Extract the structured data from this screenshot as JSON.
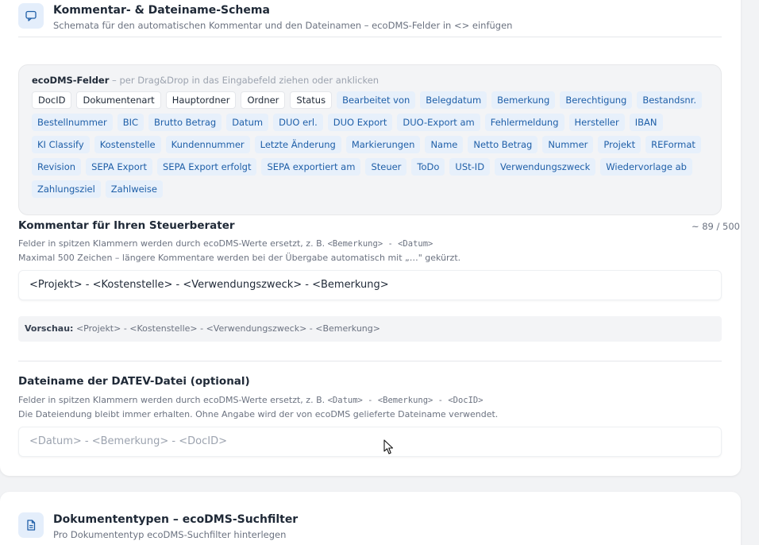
{
  "schema_section": {
    "title": "Kommentar- & Dateiname-Schema",
    "subtitle": "Schemata für den automatischen Kommentar und den Dateinamen – ecoDMS-Felder in <> einfügen",
    "icon": "chat-bubble-icon"
  },
  "fields_panel": {
    "heading": "ecoDMS-Felder",
    "hint": " – per Drag&Drop in das Eingabefeld ziehen oder anklicken",
    "chips": [
      {
        "label": "DocID",
        "style": "neutral"
      },
      {
        "label": "Dokumentenart",
        "style": "neutral"
      },
      {
        "label": "Hauptordner",
        "style": "neutral"
      },
      {
        "label": "Ordner",
        "style": "neutral"
      },
      {
        "label": "Status",
        "style": "neutral"
      },
      {
        "label": "Bearbeitet von",
        "style": "blue"
      },
      {
        "label": "Belegdatum",
        "style": "blue"
      },
      {
        "label": "Bemerkung",
        "style": "blue"
      },
      {
        "label": "Berechtigung",
        "style": "blue"
      },
      {
        "label": "Bestandsnr.",
        "style": "blue"
      },
      {
        "label": "Bestellnummer",
        "style": "blue"
      },
      {
        "label": "BIC",
        "style": "blue"
      },
      {
        "label": "Brutto Betrag",
        "style": "blue"
      },
      {
        "label": "Datum",
        "style": "blue"
      },
      {
        "label": "DUO erl.",
        "style": "blue"
      },
      {
        "label": "DUO Export",
        "style": "blue"
      },
      {
        "label": "DUO-Export am",
        "style": "blue"
      },
      {
        "label": "Fehlermeldung",
        "style": "blue"
      },
      {
        "label": "Hersteller",
        "style": "blue"
      },
      {
        "label": "IBAN",
        "style": "blue"
      },
      {
        "label": "KI Classify",
        "style": "blue"
      },
      {
        "label": "Kostenstelle",
        "style": "blue"
      },
      {
        "label": "Kundennummer",
        "style": "blue"
      },
      {
        "label": "Letzte Änderung",
        "style": "blue"
      },
      {
        "label": "Markierungen",
        "style": "blue"
      },
      {
        "label": "Name",
        "style": "blue"
      },
      {
        "label": "Netto Betrag",
        "style": "blue"
      },
      {
        "label": "Nummer",
        "style": "blue"
      },
      {
        "label": "Projekt",
        "style": "blue"
      },
      {
        "label": "REFormat",
        "style": "blue"
      },
      {
        "label": "Revision",
        "style": "blue"
      },
      {
        "label": "SEPA Export",
        "style": "blue"
      },
      {
        "label": "SEPA Export erfolgt",
        "style": "blue"
      },
      {
        "label": "SEPA exportiert am",
        "style": "blue"
      },
      {
        "label": "Steuer",
        "style": "blue"
      },
      {
        "label": "ToDo",
        "style": "blue"
      },
      {
        "label": "USt-ID",
        "style": "blue"
      },
      {
        "label": "Verwendungszweck",
        "style": "blue"
      },
      {
        "label": "Wiedervorlage ab",
        "style": "blue"
      },
      {
        "label": "Zahlungsziel",
        "style": "blue"
      },
      {
        "label": "Zahlweise",
        "style": "blue"
      }
    ]
  },
  "comment": {
    "title": "Kommentar für Ihren Steuerberater",
    "counter": "~ 89 / 500",
    "help1_prefix": "Felder in spitzen Klammern werden durch ecoDMS-Werte ersetzt, z. B. ",
    "help1_example": "<Bemerkung> - <Datum>",
    "help2": "Maximal 500 Zeichen – längere Kommentare werden bei der Übergabe automatisch mit „…\" gekürzt.",
    "value": "<Projekt> - <Kostenstelle> - <Verwendungszweck> - <Bemerkung>",
    "preview_label": "Vorschau:",
    "preview_value": " <Projekt> - <Kostenstelle> - <Verwendungszweck> - <Bemerkung>"
  },
  "filename": {
    "title": "Dateiname der DATEV-Datei (optional)",
    "help1_prefix": "Felder in spitzen Klammern werden durch ecoDMS-Werte ersetzt, z. B. ",
    "help1_example": "<Datum> - <Bemerkung> - <DocID>",
    "help2": "Die Dateiendung bleibt immer erhalten. Ohne Angabe wird der von ecoDMS gelieferte Dateiname verwendet.",
    "placeholder": "<Datum> - <Bemerkung> - <DocID>",
    "value": ""
  },
  "doctypes_section": {
    "title": "Dokumententypen – ecoDMS-Suchfilter",
    "subtitle": "Pro Dokumententyp ecoDMS-Suchfilter hinterlegen",
    "icon": "document-icon"
  },
  "colors": {
    "accent": "#1f5fa8",
    "chip_blue_bg": "#e7f0fb",
    "icon_bg": "#e4eefb"
  }
}
